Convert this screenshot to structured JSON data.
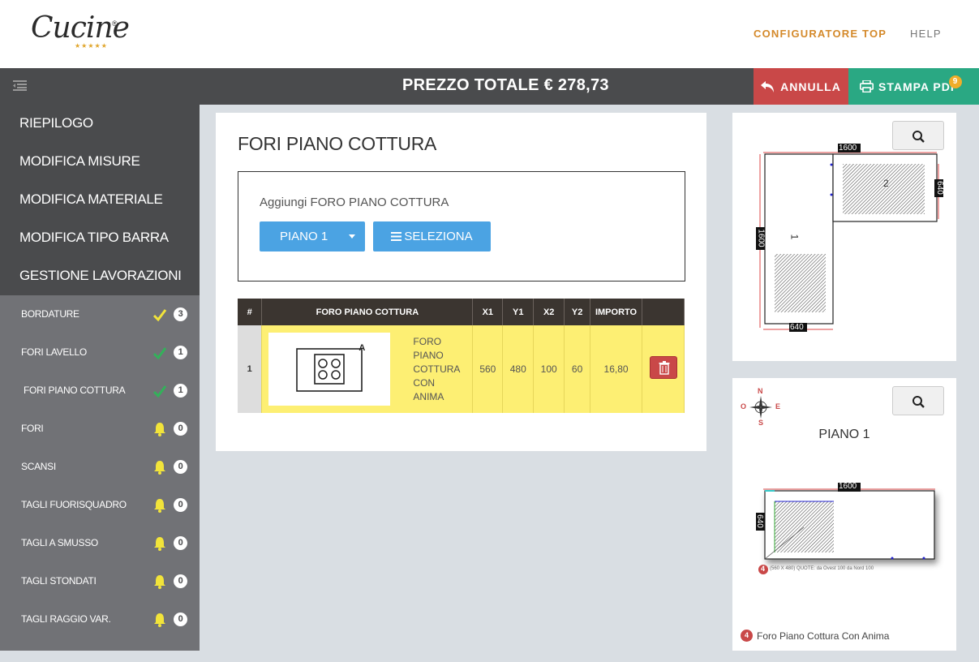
{
  "header": {
    "logo_text": "Cucine",
    "logo_reg": "®",
    "logo_stars": "★★★★★",
    "nav": [
      {
        "label": "CONFIGURATORE TOP"
      },
      {
        "label": "HELP"
      }
    ]
  },
  "pricebar": {
    "price": "PREZZO TOTALE € 278,73",
    "annulla": "ANNULLA",
    "stampa": "STAMPA PDF",
    "stampa_badge": "9"
  },
  "sidebar": {
    "main_items": [
      {
        "label": "RIEPILOGO"
      },
      {
        "label": "MODIFICA MISURE"
      },
      {
        "label": "MODIFICA MATERIALE"
      },
      {
        "label": "MODIFICA TIPO BARRA"
      },
      {
        "label": "GESTIONE LAVORAZIONI"
      }
    ],
    "sub_items": [
      {
        "label": "BORDATURE",
        "status": "check-yellow",
        "count": "3"
      },
      {
        "label": "FORI LAVELLO",
        "status": "check-green",
        "count": "1"
      },
      {
        "label": "FORI PIANO COTTURA",
        "status": "check-green",
        "count": "1"
      },
      {
        "label": "FORI",
        "status": "bell",
        "count": "0"
      },
      {
        "label": "SCANSI",
        "status": "bell",
        "count": "0"
      },
      {
        "label": "TAGLI FUORISQUADRO",
        "status": "bell",
        "count": "0"
      },
      {
        "label": "TAGLI A SMUSSO",
        "status": "bell",
        "count": "0"
      },
      {
        "label": "TAGLI STONDATI",
        "status": "bell",
        "count": "0"
      },
      {
        "label": "TAGLI RAGGIO VAR.",
        "status": "bell",
        "count": "0"
      }
    ]
  },
  "main": {
    "title": "FORI PIANO COTTURA",
    "add_label": "Aggiungi FORO PIANO COTTURA",
    "piano_button": "PIANO 1",
    "select_button": "SELEZIONA",
    "table": {
      "headers": [
        "#",
        "FORO PIANO COTTURA",
        "X1",
        "Y1",
        "X2",
        "Y2",
        "IMPORTO",
        ""
      ],
      "rows": [
        {
          "num": "1",
          "thumb_label": "A",
          "desc": "FORO PIANO COTTURA CON ANIMA",
          "x1": "560",
          "y1": "480",
          "x2": "100",
          "y2": "60",
          "importo": "16,80"
        }
      ]
    }
  },
  "preview1": {
    "dim_top": "1600",
    "dim_right": "640",
    "dim_left": "1600",
    "dim_bottom": "640",
    "label_1": "1",
    "label_2": "2"
  },
  "preview2": {
    "title": "PIANO 1",
    "compass": {
      "n": "N",
      "s": "S",
      "e": "E",
      "o": "O"
    },
    "dim_top": "1600",
    "dim_left": "640",
    "marker": "4",
    "note": "(560 X 480) QUOTE: da Ovest 100 da Nord 100",
    "legend_num": "4",
    "legend": "Foro Piano Cottura Con Anima"
  },
  "colors": {
    "accent_orange": "#d4892a",
    "annulla_red": "#c94848",
    "stampa_green": "#2aa883",
    "button_blue": "#4ba3e3",
    "row_yellow": "#fdef73"
  }
}
